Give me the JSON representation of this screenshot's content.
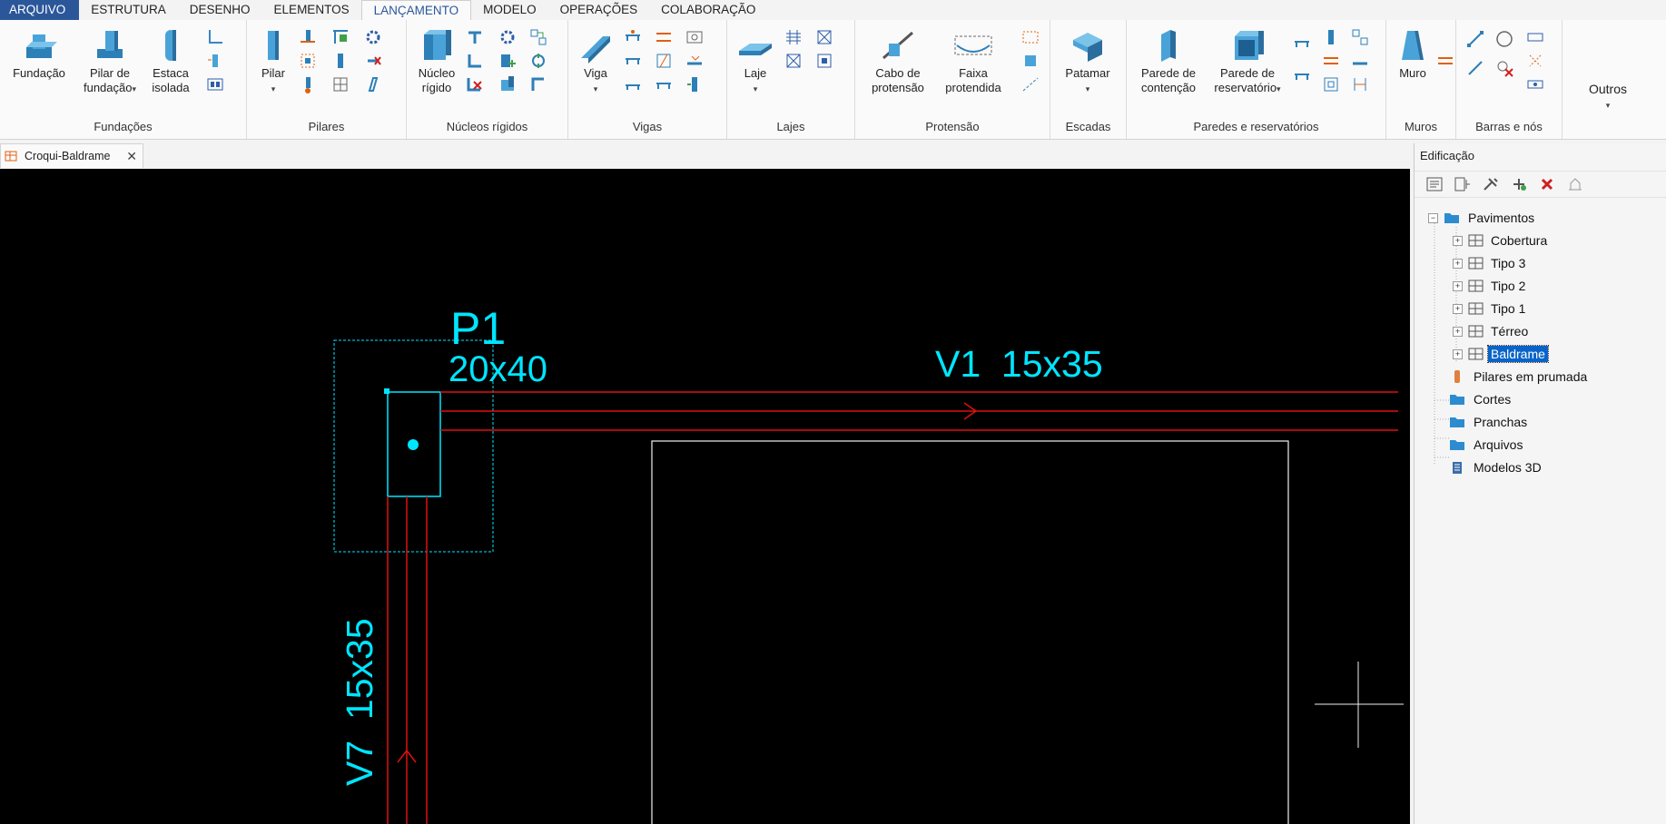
{
  "menu_tabs": [
    "ARQUIVO",
    "ESTRUTURA",
    "DESENHO",
    "ELEMENTOS",
    "LANÇAMENTO",
    "MODELO",
    "OPERAÇÕES",
    "COLABORAÇÃO"
  ],
  "ribbon": {
    "fundacoes": {
      "label": "Fundações",
      "fundacao": "Fundação",
      "pilar_fundacao_1": "Pilar de",
      "pilar_fundacao_2": "fundação",
      "estaca_1": "Estaca",
      "estaca_2": "isolada"
    },
    "pilares": {
      "label": "Pilares",
      "pilar": "Pilar"
    },
    "nucleos": {
      "label": "Núcleos rígidos",
      "nucleo_1": "Núcleo",
      "nucleo_2": "rígido"
    },
    "vigas": {
      "label": "Vigas",
      "viga": "Viga"
    },
    "lajes": {
      "label": "Lajes",
      "laje": "Laje"
    },
    "protensao": {
      "label": "Protensão",
      "cabo_1": "Cabo de",
      "cabo_2": "protensão",
      "faixa_1": "Faixa",
      "faixa_2": "protendida"
    },
    "escadas": {
      "label": "Escadas",
      "patamar": "Patamar"
    },
    "paredes": {
      "label": "Paredes e reservatórios",
      "contencao_1": "Parede de",
      "contencao_2": "contenção",
      "reservatorio_1": "Parede de",
      "reservatorio_2": "reservatório"
    },
    "muros": {
      "label": "Muros",
      "muro": "Muro"
    },
    "barras": {
      "label": "Barras e nós"
    },
    "outros": {
      "label": "Outros"
    }
  },
  "doc_tab": {
    "title": "Croqui-Baldrame"
  },
  "drawing": {
    "pillar_name": "P1",
    "pillar_dims": "20x40",
    "beam_v1": "V1  15x35",
    "beam_v7": "V7  15x35"
  },
  "panel": {
    "title": "Edificação",
    "tree": {
      "root": "Pavimentos",
      "floors": [
        "Cobertura",
        "Tipo 3",
        "Tipo 2",
        "Tipo 1",
        "Térreo",
        "Baldrame"
      ],
      "selected_floor": "Baldrame",
      "others": [
        "Pilares em prumada",
        "Cortes",
        "Pranchas",
        "Arquivos",
        "Modelos 3D"
      ]
    }
  },
  "colors": {
    "accent": "#2b579a",
    "canvas": "#000000",
    "cad_cyan": "#00e5ff",
    "cad_red": "#e01010",
    "selection": "#0a64c8"
  }
}
